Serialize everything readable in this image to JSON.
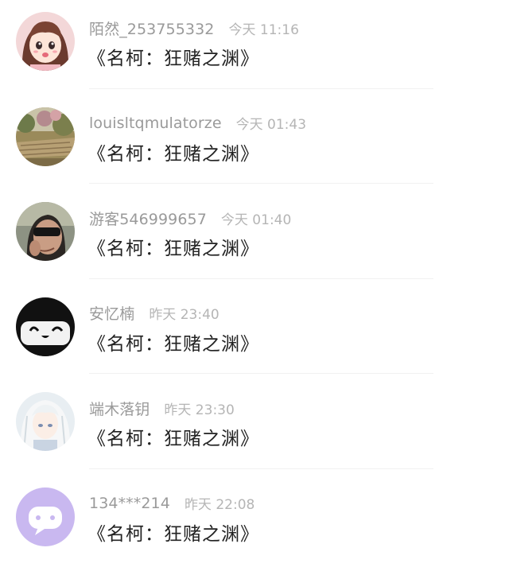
{
  "comments": [
    {
      "user": "陌然_253755332",
      "time": "今天 11:16",
      "text": "《名柯：狂赌之渊》",
      "avatar_icon": "anime-girl-avatar-icon"
    },
    {
      "user": "louisltqmulatorze",
      "time": "今天 01:43",
      "text": "《名柯：狂赌之渊》",
      "avatar_icon": "garden-path-avatar-icon"
    },
    {
      "user": "游客546999657",
      "time": "今天 01:40",
      "text": "《名柯：狂赌之渊》",
      "avatar_icon": "person-sunglasses-avatar-icon"
    },
    {
      "user": "安忆楠",
      "time": "昨天 23:40",
      "text": "《名柯：狂赌之渊》",
      "avatar_icon": "black-cartoon-face-avatar-icon"
    },
    {
      "user": "端木落钥",
      "time": "昨天 23:30",
      "text": "《名柯：狂赌之渊》",
      "avatar_icon": "white-hair-anime-avatar-icon"
    },
    {
      "user": "134***214",
      "time": "昨天 22:08",
      "text": "《名柯：狂赌之渊》",
      "avatar_icon": "default-chat-bubble-avatar-icon"
    }
  ],
  "colors": {
    "username": "#9a9a9a",
    "time": "#b5b5b5",
    "message": "#222222",
    "default_avatar_bg": "#c9b8f0"
  }
}
